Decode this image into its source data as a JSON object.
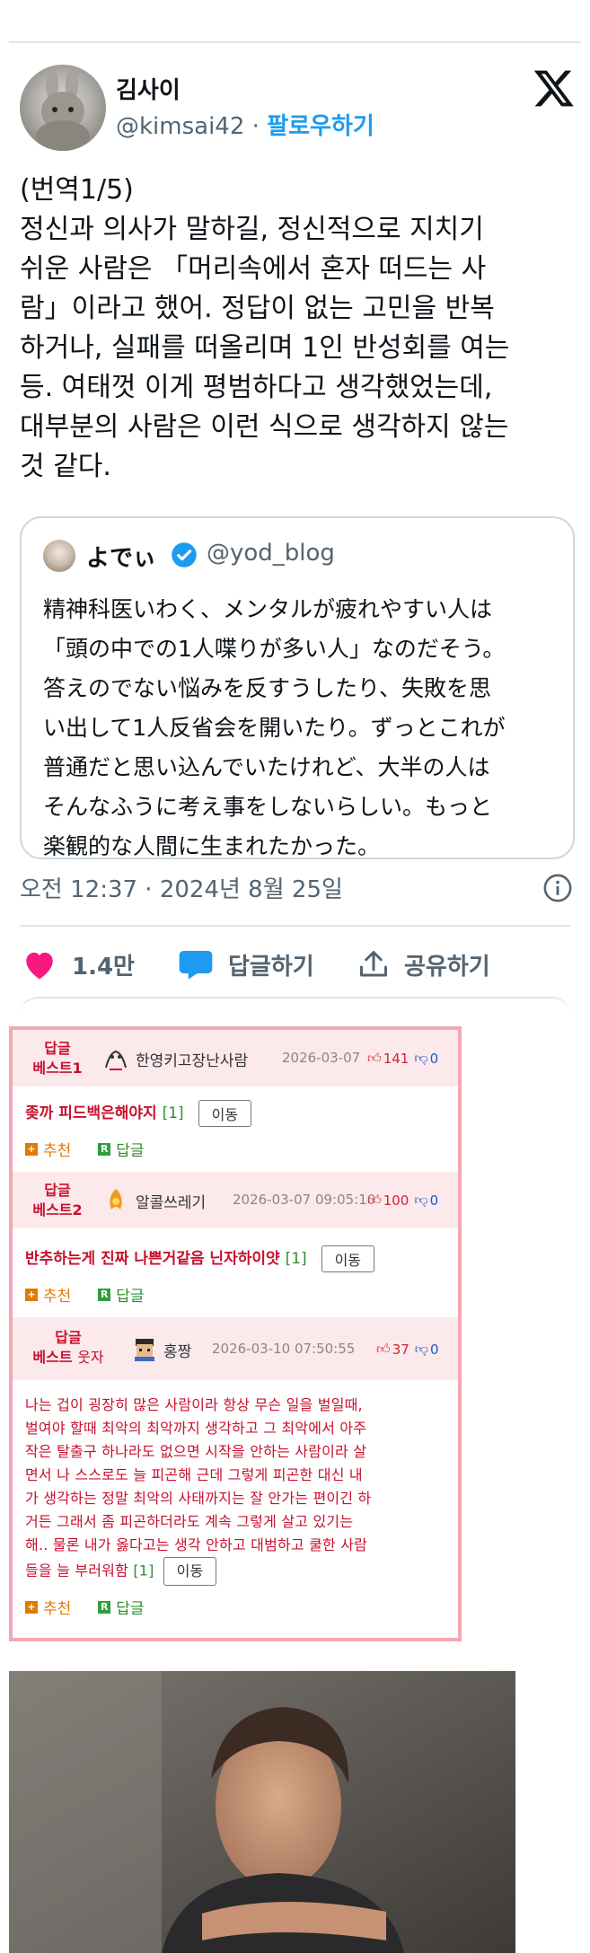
{
  "tweet": {
    "name": "김사이",
    "handle": "@kimsai42",
    "separator": " · ",
    "follow_label": "팔로우하기",
    "text_lines": [
      "(번역1/5)",
      "정신과 의사가 말하길, 정신적으로 지치기",
      "쉬운 사람은 「머리속에서 혼자 떠드는 사",
      "람」이라고 했어. 정답이 없는 고민을 반복",
      "하거나, 실패를 떠올리며 1인 반성회를 여는",
      "등. 여태껏 이게 평범하다고 생각했었는데,",
      "대부분의 사람은 이런 식으로 생각하지 않는",
      "것 같다."
    ],
    "timestamp": "오전 12:37 · 2024년 8월 25일",
    "like_count": "1.4만",
    "reply_label": "답글하기",
    "share_label": "공유하기"
  },
  "quote": {
    "name": "よでぃ",
    "handle": "@yod_blog",
    "text_lines": [
      "精神科医いわく、メンタルが疲れやすい人は",
      "「頭の中での1人喋りが多い人」なのだそう。",
      "答えのでない悩みを反すうしたり、失敗を思",
      "い出して1人反省会を開いたり。ずっとこれが",
      "普通だと思い込んでいたけれど、大半の人は",
      "そんなふうに考え事をしないらしい。もっと",
      "楽観的な人間に生まれたかった。"
    ]
  },
  "comments": [
    {
      "badge_line1": "답글",
      "badge_line2": "베스트1",
      "user": "한영키고장난사람",
      "date": "2026-03-07",
      "up": "141",
      "down": "0",
      "body": "좆까 피드백은해야지",
      "reply_count": "[1]",
      "move_label": "이동",
      "recommend_label": "추천",
      "reply_label": "답글"
    },
    {
      "badge_line1": "답글",
      "badge_line2": "베스트2",
      "user": "알콜쓰레기",
      "date": "2026-03-07 09:05:10",
      "up": "100",
      "down": "0",
      "body": "반추하는게 진짜 나쁜거같음 닌자하이얏",
      "reply_count": "[1]",
      "move_label": "이동",
      "recommend_label": "추천",
      "reply_label": "답글"
    },
    {
      "badge_line1": "답글",
      "badge_line2a": "베스트",
      "badge_line2b": "웃자",
      "user": "홍짱",
      "date": "2026-03-10 07:50:55",
      "up": "37",
      "down": "0",
      "body_lines": [
        "나는 겁이 굉장히 많은 사람이라 항상 무슨 일을 벌일때,",
        "벌여야 할때 최악의 최악까지 생각하고 그 최악에서 아주",
        "작은 탈출구 하나라도 없으면 시작을 안하는 사람이라 살",
        "면서 나 스스로도 늘 피곤해 근데 그렇게 피곤한 대신 내",
        "가 생각하는 정말 최악의 사태까지는 잘 안가는 편이긴 하",
        "거든 그래서 좀 피곤하더라도 계속 그렇게 살고 있기는",
        "해.. 물론 내가 옳다고는 생각 안하고 대범하고 쿨한 사람",
        "들을 늘 부러워함"
      ],
      "reply_count": "[1]",
      "move_label": "이동",
      "recommend_label": "추천",
      "reply_label": "답글"
    }
  ],
  "colors": {
    "accent_blue": "#1d9bf0",
    "like_pink": "#f91880",
    "comment_red": "#c8102e",
    "comment_border": "#f4a7b5"
  }
}
